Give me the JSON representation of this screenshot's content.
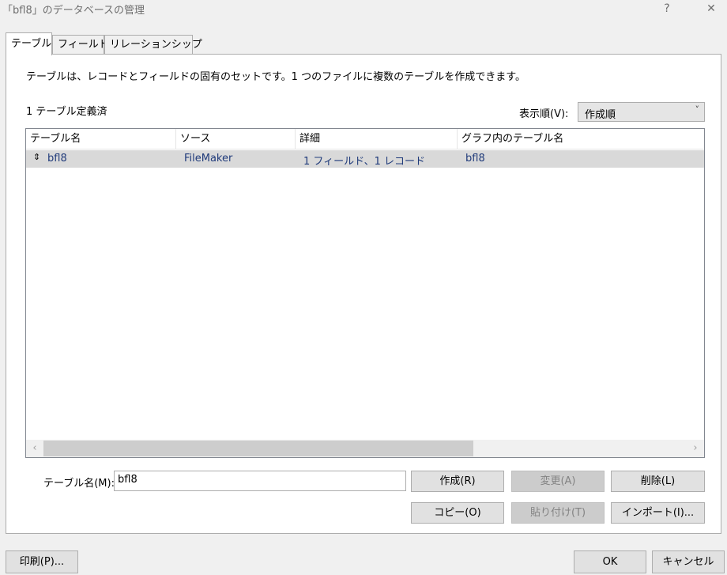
{
  "window": {
    "title": "「bfl8」のデータベースの管理",
    "help_label": "?",
    "close_label": "✕"
  },
  "tabs": [
    {
      "label": "テーブル",
      "active": true
    },
    {
      "label": "フィールド",
      "active": false
    },
    {
      "label": "リレーションシップ",
      "active": false
    }
  ],
  "description": "テーブルは、レコードとフィールドの固有のセットです。1 つのファイルに複数のテーブルを作成できます。",
  "table_count": "1 テーブル定義済",
  "sort": {
    "label": "表示順(V):",
    "value": "作成順"
  },
  "list": {
    "columns": [
      "テーブル名",
      "ソース",
      "詳細",
      "グラフ内のテーブル名"
    ],
    "rows": [
      {
        "name": "bfl8",
        "source": "FileMaker",
        "details": "1 フィールド、1 レコード",
        "graph_name": "bfl8"
      }
    ]
  },
  "name_field": {
    "label": "テーブル名(M):",
    "value": "bfl8"
  },
  "buttons": {
    "create": "作成(R)",
    "change": "変更(A)",
    "delete": "削除(L)",
    "copy": "コピー(O)",
    "paste": "貼り付け(T)",
    "import": "インポート(I)...",
    "print": "印刷(P)...",
    "ok": "OK",
    "cancel": "キャンセル"
  }
}
